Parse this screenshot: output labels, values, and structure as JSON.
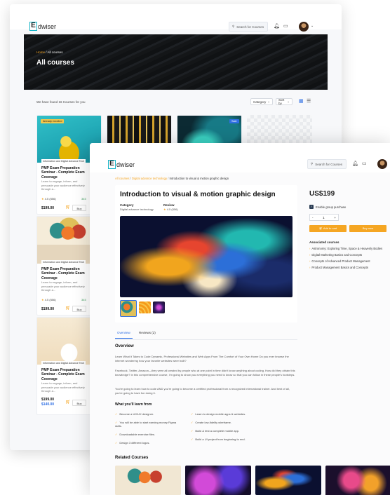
{
  "back": {
    "brand_mark": "E",
    "brand_text": "dwiser",
    "search_placeholder": "Search for Courses",
    "breadcrumb_home": "Home",
    "breadcrumb_current": " / All courses",
    "page_title": "All courses",
    "result_text": "We have found 16 Courses for you",
    "category_label": "Category",
    "sort_label": "Sort by",
    "cards": [
      {
        "badge": "Already enrolled",
        "category": "Information and Digital Advance Tech",
        "title": "PMP Exam Preparation Seminar - Complete Exam Coverage",
        "desc": "Learn to engage, inform, and persuade your audience effectively through a...",
        "rating": "4.5 (556)",
        "extra": "345",
        "price": "$199.00",
        "buy": "Buy"
      },
      {
        "badge": "",
        "category": "Information and Digital Advance Tech",
        "title": "PMP Exam Preparation Seminar - Complete Exam Coverage",
        "desc": "Learn to engage, inform, and persuade your audience effectively through a...",
        "rating": "4.5 (556)",
        "extra": "345",
        "price": "$199.00",
        "buy": "Buy"
      },
      {
        "badge": "",
        "category": "Information and Digital Advance Tech",
        "title": "PMP Exam Preparation Seminar - Complete Exam Coverage",
        "desc": "Learn to engage, inform, and persuade your audience effectively through a...",
        "rating": "",
        "extra": "",
        "price": "$199.00",
        "price_sale": "$140.00",
        "buy": "Buy"
      }
    ],
    "sale_badge": "Sale"
  },
  "front": {
    "brand_mark": "E",
    "brand_text": "dwiser",
    "search_placeholder": "Search for Courses",
    "breadcrumb_1": "All courses",
    "breadcrumb_2": "Digital advance technology",
    "breadcrumb_3": "Introduction to visual & motion graphic design",
    "title": "Introduction to visual & motion graphic design",
    "category_label": "Category",
    "category_value": "Digital advance technology",
    "review_label": "Review",
    "review_value": "4.5 (556)",
    "price": "US$199",
    "group_label": "Enable group purchase",
    "qty": "1",
    "qty_minus": "-",
    "qty_plus": "+",
    "add_to_cart": "Add to cart",
    "buy_now": "Buy now",
    "associated_title": "Associated courses",
    "associated": [
      "Astronomy: Exploring Time, Space & Heavenly Bodies",
      "Digital Marketing Basics and Concepts",
      "Concepts of Advanced Product Management",
      "Product Management Basics and Concepts"
    ],
    "tabs": [
      "Overview",
      "Reviews (2)"
    ],
    "overview_title": "Overview",
    "overview_p1": "Learn What It Takes to Code Dynamic, Professional Websites and Web Apps From The Comfort of Your Own Home Do you ever browse the internet wondering how your favorite websites were built?",
    "overview_p2": "Facebook, Twitter, Amazon—they were all created by people who at one point in time didn't know anything about coding. How did they obtain this knowledge? In this comprehensive course, I'm going to show you everything you need to know so that you can follow in these people's footsteps.",
    "overview_p3": "You're going to learn how to code AND you're going to become a certified professional from a recognized international trainer. And best of all, you're going to have fun doing it.",
    "learn_title": "What you'll learn from",
    "learn_left": [
      "Become a UX/UX designer.",
      "You will be able to start earning money Figma skills.",
      "Downloadable exercise files.",
      "Design 3 different logos."
    ],
    "learn_right": [
      "Learn to design mobile apps & websites.",
      "Create low-fidelity wireframe.",
      "Build & test a complete mobile app.",
      "Build a UI project from beginning to end."
    ],
    "related_title": "Related Courses"
  }
}
